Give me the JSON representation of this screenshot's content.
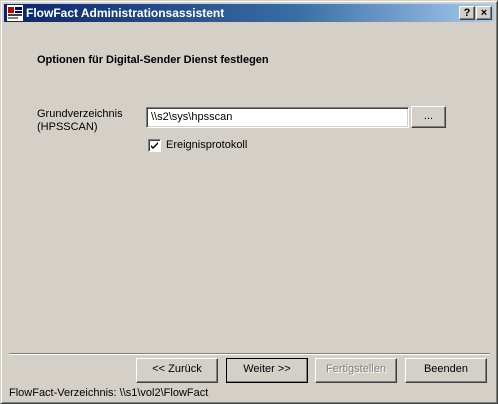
{
  "window": {
    "title": "FlowFact Administrationsassistent",
    "help_label": "?",
    "close_label": "×",
    "icon": "flowfact-app-icon"
  },
  "page": {
    "heading": "Optionen für Digital-Sender Dienst festlegen"
  },
  "form": {
    "directory_label_line1": "Grundverzeichnis",
    "directory_label_line2": "(HPSSCAN)",
    "directory_value": "\\\\s2\\sys\\hpsscan",
    "browse_label": "...",
    "event_log_label": "Ereignisprotokoll",
    "event_log_checked": true
  },
  "buttons": {
    "back": "<< Zurück",
    "next": "Weiter >>",
    "finish": "Fertigstellen",
    "quit": "Beenden",
    "finish_disabled": true
  },
  "status": {
    "text": "FlowFact-Verzeichnis: \\\\s1\\vol2\\FlowFact"
  },
  "colors": {
    "titlebar_start": "#0a246a",
    "titlebar_end": "#a6caf0",
    "face": "#d4d0c8"
  }
}
